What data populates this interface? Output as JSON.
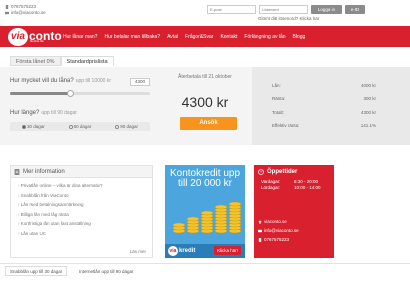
{
  "contact": {
    "phone": "0767575223",
    "email": "info@viaconto.se"
  },
  "login": {
    "email_placeholder": "E-post",
    "password_placeholder": "Lösenord",
    "login_label": "Logga in",
    "extra_label": "e-ID",
    "forgot": "Glömt ditt lösenord? Klicka här"
  },
  "brand": {
    "logo_via": "via",
    "logo_conto": "conto",
    "tagline": "flexibla lån",
    "color": "#d9202e"
  },
  "nav": [
    "Hur lånar man?",
    "Hur betalar man tillbaka?",
    "Avtal",
    "Frågor&Svar",
    "Kontakt",
    "Förlängning av lån",
    "Blogg"
  ],
  "tabs": [
    "Första lånet 0%",
    "Standardprislista"
  ],
  "calculator": {
    "q_amount": "Hur mycket vill du låna?",
    "q_amount_hint": "upp till 10000 kr",
    "amount_value": "4300",
    "amount_fraction": 0.43,
    "q_days": "Hur länge?",
    "q_days_hint": "upp till 90 dagar",
    "day_options": [
      "30 dagar",
      "60 dagar",
      "90 dagar"
    ],
    "repay_label": "Återbetala till 21 oktober",
    "amount_display": "4300 kr",
    "apply_label": "Ansök"
  },
  "summary": [
    {
      "label": "Lån:",
      "value": "4000 kr"
    },
    {
      "label": "Ränta:",
      "value": "300 kr"
    },
    {
      "label": "Totalt:",
      "value": "4300 kr"
    },
    {
      "label": "Effektiv ränta:",
      "value": "141.1%"
    }
  ],
  "info": {
    "title": "Mer information",
    "items": [
      "Privatlån online – vilka är dina alternativ?",
      "Snabblån från ViaConto",
      "Lån med betalningsanmärkning",
      "Billiga lån med låg ränta",
      "Kortfristiga lån utan fast anställning",
      "Lån utan UC"
    ],
    "more": "Läs mer"
  },
  "banner": {
    "title": "Kontokredit upp till 20 000 kr",
    "logo_via": "via",
    "logo_kredit": "kredit",
    "cta": "Klicka här!"
  },
  "hours": {
    "title": "Öppettider",
    "rows": [
      {
        "day": "Vardagar:",
        "time": "8:30 - 20:00"
      },
      {
        "day": "Lördagar:",
        "time": "10:00 - 14:00"
      }
    ],
    "contacts": [
      "viaconto.se",
      "info@viaconto.se",
      "0767575223"
    ]
  },
  "bottom_tabs": [
    "Snabblån upp till 30 dagar",
    "Internetlån upp till 90 dagar"
  ]
}
